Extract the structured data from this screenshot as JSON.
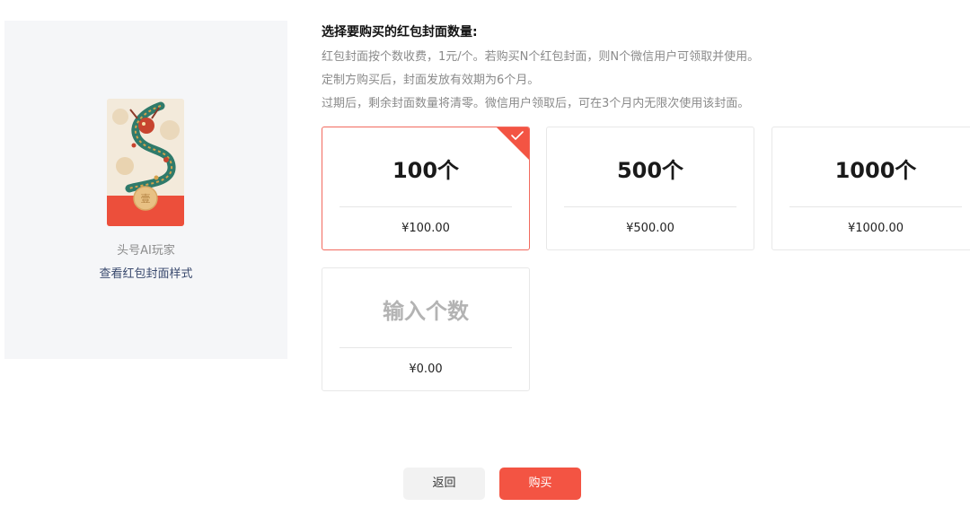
{
  "preview": {
    "name": "头号AI玩家",
    "view_style_link": "查看红包封面样式",
    "cover_image": "red-envelope-cover-dragon",
    "cover_seal_char": "壹"
  },
  "purchase": {
    "title": "选择要购买的红包封面数量:",
    "descriptions": [
      "红包封面按个数收费，1元/个。若购买N个红包封面，则N个微信用户可领取并使用。",
      "定制方购买后，封面发放有效期为6个月。",
      "过期后，剩余封面数量将清零。微信用户领取后，可在3个月内无限次使用该封面。"
    ],
    "options": [
      {
        "quantity": "100个",
        "price": "¥100.00",
        "selected": true
      },
      {
        "quantity": "500个",
        "price": "¥500.00",
        "selected": false
      },
      {
        "quantity": "1000个",
        "price": "¥1000.00",
        "selected": false
      }
    ],
    "custom_option": {
      "placeholder": "输入个数",
      "price": "¥0.00"
    },
    "selected_check_icon": "check-icon"
  },
  "footer": {
    "back_label": "返回",
    "buy_label": "购买"
  },
  "colors": {
    "accent": "#f35443",
    "selected_border": "#f26a5e",
    "panel_bg": "#f5f6f8",
    "link": "#3a4a6e"
  }
}
